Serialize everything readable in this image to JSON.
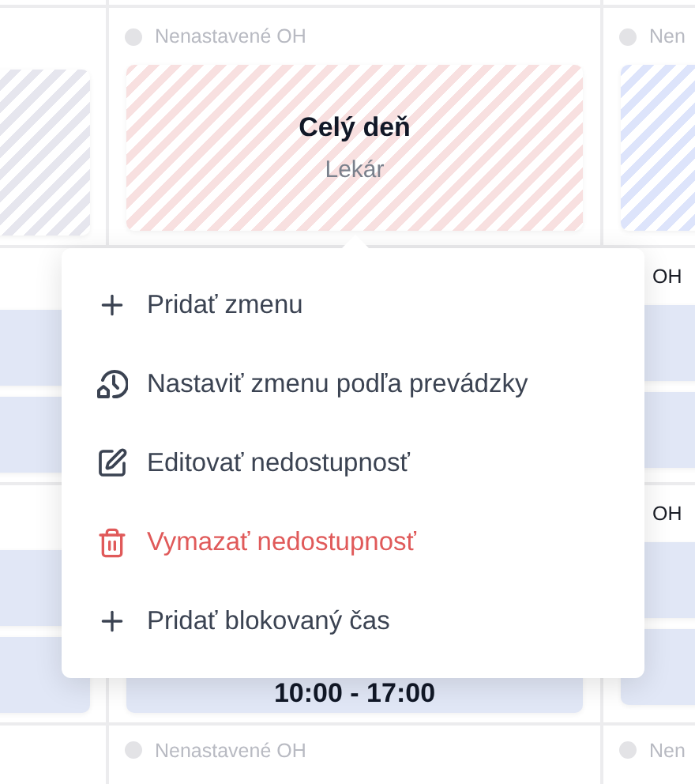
{
  "calendar": {
    "rows": [
      {
        "cells": [
          {
            "cards": [
              {
                "kind": "striped",
                "color": "#e6e6ee"
              }
            ]
          },
          {
            "status": {
              "kind": "unset",
              "label": "Nenastavené OH"
            },
            "cards": [
              {
                "kind": "striped",
                "color": "#f8e0e0",
                "title": "Celý deň",
                "subtitle": "Lekár"
              }
            ]
          },
          {
            "status": {
              "kind": "unset",
              "label": "Nen"
            },
            "cards": [
              {
                "kind": "striped",
                "color": "#dde4fb"
              }
            ]
          }
        ]
      },
      {
        "cells": [
          {
            "cards": [
              {
                "kind": "shift"
              },
              {
                "kind": "shift"
              }
            ]
          },
          {},
          {
            "status": {
              "kind": "set",
              "label": "OH"
            },
            "cards": [
              {
                "kind": "shift"
              },
              {
                "kind": "shift"
              }
            ]
          }
        ]
      },
      {
        "cells": [
          {
            "cards": [
              {
                "kind": "shift"
              },
              {
                "kind": "shift"
              }
            ]
          },
          {
            "cards": [
              {
                "kind": "shift",
                "time": "10:00 - 17:00"
              }
            ]
          },
          {
            "status": {
              "kind": "set",
              "label": "OH"
            },
            "cards": [
              {
                "kind": "shift"
              },
              {
                "kind": "shift"
              }
            ]
          }
        ]
      },
      {
        "cells": [
          {},
          {
            "status": {
              "kind": "unset",
              "label": "Nenastavené OH"
            }
          },
          {
            "status": {
              "kind": "unset",
              "label": "Nen"
            }
          }
        ]
      }
    ]
  },
  "context_menu": {
    "items": [
      {
        "kind": "add",
        "label": "Pridať zmenu",
        "danger": false
      },
      {
        "kind": "schedule",
        "label": "Nastaviť zmenu podľa prevádzky",
        "danger": false
      },
      {
        "kind": "edit",
        "label": "Editovať nedostupnosť",
        "danger": false
      },
      {
        "kind": "delete",
        "label": "Vymazať nedostupnosť",
        "danger": true
      },
      {
        "kind": "add",
        "label": "Pridať blokovaný čas",
        "danger": false
      }
    ]
  }
}
